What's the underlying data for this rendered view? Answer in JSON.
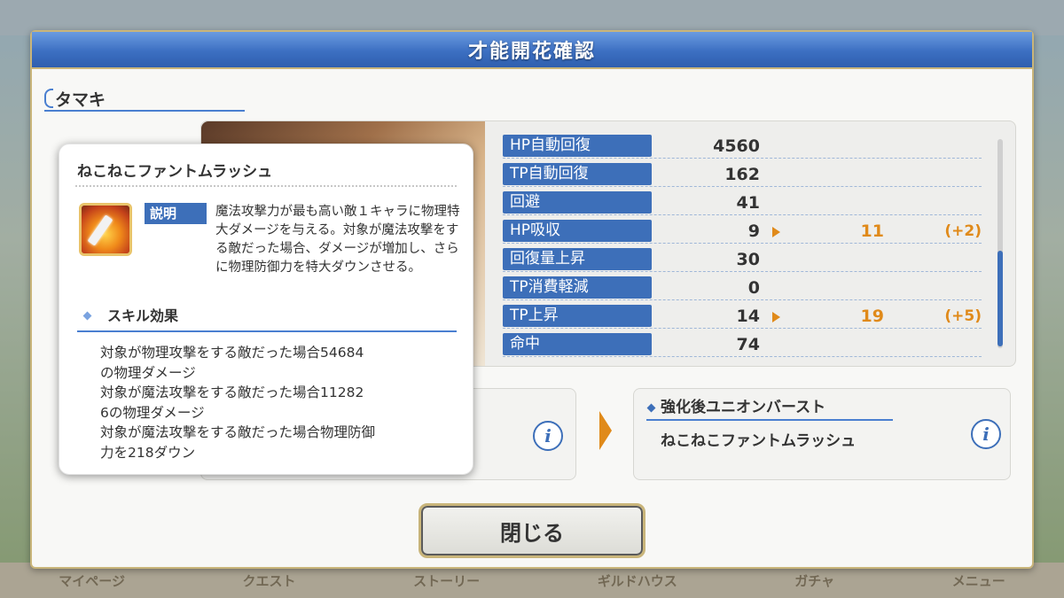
{
  "dialog": {
    "title": "才能開花確認"
  },
  "character": {
    "name": "タマキ"
  },
  "stats": [
    {
      "label": "HP自動回復",
      "value": "4560"
    },
    {
      "label": "TP自動回復",
      "value": "162"
    },
    {
      "label": "回避",
      "value": "41"
    },
    {
      "label": "HP吸収",
      "value": "9",
      "new_value": "11",
      "diff": "(+2)"
    },
    {
      "label": "回復量上昇",
      "value": "30"
    },
    {
      "label": "TP消費軽減",
      "value": "0"
    },
    {
      "label": "TP上昇",
      "value": "14",
      "new_value": "19",
      "diff": "(+5)"
    },
    {
      "label": "命中",
      "value": "74"
    }
  ],
  "union_burst": {
    "header": "強化後ユニオンバースト",
    "name": "ねこねこファントムラッシュ"
  },
  "close_button": {
    "label": "閉じる"
  },
  "popup": {
    "title": "ねこねこファントムラッシュ",
    "desc_label": "説明",
    "description": "魔法攻撃力が最も高い敵１キャラに物理特大ダメージを与える。対象が魔法攻撃をする敵だった場合、ダメージが増加し、さらに物理防御力を特大ダウンさせる。",
    "effects_header": "スキル効果",
    "effects": [
      "対象が物理攻撃をする敵だった場合54684",
      "の物理ダメージ",
      "対象が魔法攻撃をする敵だった場合11282",
      "6の物理ダメージ",
      "対象が魔法攻撃をする敵だった場合物理防御",
      "力を218ダウン"
    ]
  },
  "bottom_nav": [
    "マイページ",
    "クエスト",
    "ストーリー",
    "ギルドハウス",
    "ガチャ",
    "メニュー"
  ],
  "colors": {
    "accent_blue": "#3d6fb9",
    "orange": "#e08a1a",
    "gold_border": "#c9b57a"
  }
}
